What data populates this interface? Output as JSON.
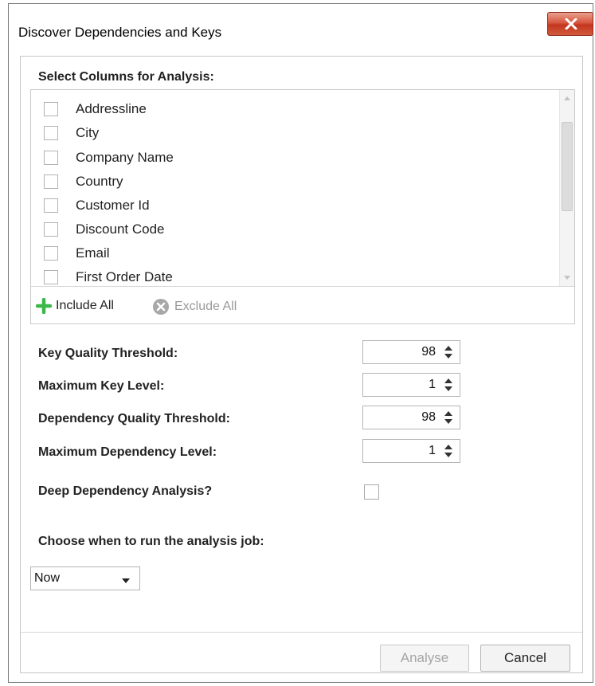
{
  "window": {
    "title": "Discover Dependencies and Keys",
    "close_icon": "close-icon"
  },
  "columns_section": {
    "heading": "Select Columns for Analysis:",
    "items": [
      {
        "label": "Addressline",
        "checked": false
      },
      {
        "label": "City",
        "checked": false
      },
      {
        "label": "Company Name",
        "checked": false
      },
      {
        "label": "Country",
        "checked": false
      },
      {
        "label": "Customer Id",
        "checked": false
      },
      {
        "label": "Discount Code",
        "checked": false
      },
      {
        "label": "Email",
        "checked": false
      },
      {
        "label": "First Order Date",
        "checked": false
      }
    ],
    "include_all_label": "Include All",
    "exclude_all_label": "Exclude All",
    "include_icon": "plus-icon",
    "exclude_icon": "remove-circle-icon"
  },
  "settings": {
    "key_quality_threshold": {
      "label": "Key Quality Threshold:",
      "value": "98"
    },
    "maximum_key_level": {
      "label": "Maximum Key Level:",
      "value": "1"
    },
    "dependency_quality_threshold": {
      "label": "Dependency Quality Threshold:",
      "value": "98"
    },
    "maximum_dependency_level": {
      "label": "Maximum Dependency Level:",
      "value": "1"
    },
    "deep_dependency_analysis": {
      "label": "Deep Dependency Analysis?",
      "checked": false
    }
  },
  "schedule": {
    "label": "Choose when to run the analysis job:",
    "selected": "Now"
  },
  "buttons": {
    "analyse_label": "Analyse",
    "analyse_enabled": false,
    "cancel_label": "Cancel"
  },
  "colors": {
    "close_button": "#c2361f",
    "include_icon": "#3cb84a",
    "exclude_icon": "#a8a8a8",
    "disabled_text": "#a5a5a5"
  }
}
